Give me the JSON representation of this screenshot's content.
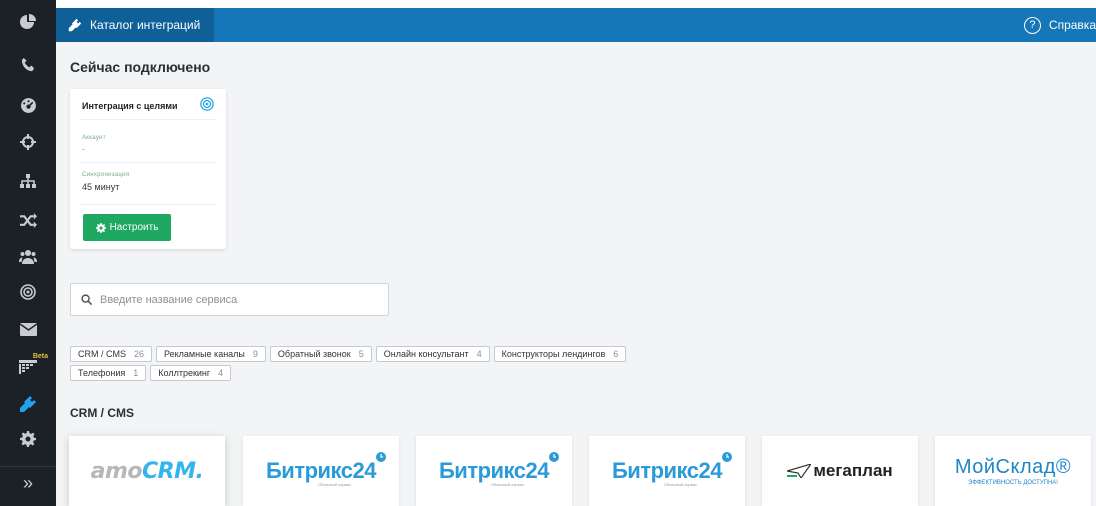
{
  "sidebar": {
    "items": [
      {
        "icon": "pie-chart-icon"
      },
      {
        "icon": "phone-icon"
      },
      {
        "icon": "dashboard-gauge-icon"
      },
      {
        "icon": "crosshair-icon"
      },
      {
        "icon": "sitemap-icon"
      },
      {
        "icon": "shuffle-icon"
      },
      {
        "icon": "users-icon"
      },
      {
        "icon": "target-icon"
      },
      {
        "icon": "envelope-icon"
      },
      {
        "icon": "grid-board-icon",
        "badge": "Beta"
      },
      {
        "icon": "plug-icon",
        "active": true
      },
      {
        "icon": "gear-icon"
      }
    ],
    "expand_label": "»"
  },
  "topbar": {
    "tab_label": "Каталог интеграций",
    "help_glyph": "?",
    "help_label": "Справка"
  },
  "connected": {
    "heading": "Сейчас подключено",
    "card": {
      "title": "Интеграция с целями",
      "account_label": "Аккаунт",
      "account_value": "-",
      "sync_label": "Синхронизация",
      "sync_value": "45 минут",
      "button_label": "Настроить"
    }
  },
  "search": {
    "placeholder": "Введите название сервиса"
  },
  "filters": [
    [
      {
        "label": "CRM / CMS",
        "count": "26"
      },
      {
        "label": "Рекламные каналы",
        "count": "9"
      },
      {
        "label": "Обратный звонок",
        "count": "5"
      },
      {
        "label": "Онлайн консультант",
        "count": "4"
      },
      {
        "label": "Конструкторы лендингов",
        "count": "6"
      }
    ],
    [
      {
        "label": "Телефония",
        "count": "1"
      },
      {
        "label": "Коллтрекинг",
        "count": "4"
      }
    ]
  ],
  "category": {
    "heading": "CRM / CMS",
    "tiles": [
      {
        "logo_a": "amo",
        "logo_b": "CRM."
      },
      {
        "logo": "Битрикс24",
        "sub": "Облачный сервис"
      },
      {
        "logo": "Битрикс24",
        "sub": "Облачный сервис"
      },
      {
        "logo": "Битрикс24",
        "sub": "Облачный сервис"
      },
      {
        "logo": "мегаплан"
      },
      {
        "logo": "МойСклад®",
        "tagline": "ЭФФЕКТИВНОСТЬ ДОСТУПНА!"
      }
    ]
  },
  "colors": {
    "sidebar_bg": "#1c2128",
    "topbar_bg": "#1577b8",
    "accent_blue": "#20a3f0",
    "button_green": "#1fa862"
  }
}
